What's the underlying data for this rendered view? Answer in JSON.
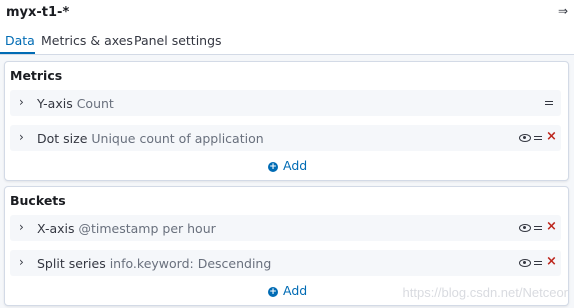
{
  "header": {
    "index_pattern": "myx-t1-*",
    "collapse_icon": "⇒"
  },
  "tabs": [
    {
      "label": "Data",
      "active": true
    },
    {
      "label": "Metrics & axes",
      "active": false
    },
    {
      "label": "Panel settings",
      "active": false
    }
  ],
  "metrics": {
    "title": "Metrics",
    "rows": [
      {
        "name": "Y-axis",
        "desc": "Count"
      },
      {
        "name": "Dot size",
        "desc": "Unique count of application"
      }
    ],
    "add_label": "Add"
  },
  "buckets": {
    "title": "Buckets",
    "rows": [
      {
        "name": "X-axis",
        "desc": "@timestamp per hour"
      },
      {
        "name": "Split series",
        "desc": "info.keyword: Descending"
      }
    ],
    "add_label": "Add"
  },
  "watermark": "https://blog.csdn.net/Netceor",
  "colors": {
    "accent": "#006bb4",
    "danger": "#bd271e",
    "text": "#343741",
    "muted": "#69707d"
  },
  "icons": {
    "chevron": "chevron-right-icon",
    "visibility": "eye-icon",
    "drag": "drag-handle-icon",
    "remove": "remove-icon",
    "add": "plus-circle-icon"
  }
}
